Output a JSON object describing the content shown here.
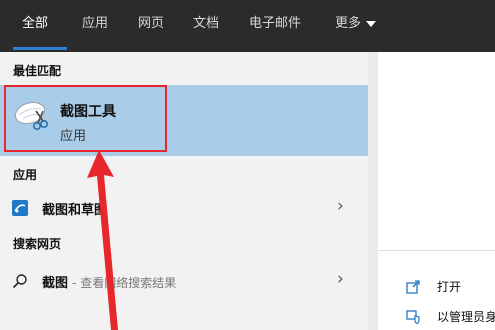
{
  "tabs": [
    {
      "label": "全部",
      "active": true
    },
    {
      "label": "应用"
    },
    {
      "label": "网页"
    },
    {
      "label": "文档"
    },
    {
      "label": "电子邮件"
    },
    {
      "label": "更多"
    }
  ],
  "sections": {
    "best_match": "最佳匹配",
    "apps": "应用",
    "web": "搜索网页"
  },
  "best_match": {
    "title": "截图工具",
    "subtitle": "应用",
    "icon": "snipping-tool-icon"
  },
  "apps": [
    {
      "label": "截图和草图",
      "icon": "snip-sketch-icon"
    }
  ],
  "web_results": [
    {
      "query": "截图",
      "hint": "- 查看网络搜索结果",
      "icon": "search-icon"
    }
  ],
  "actions": [
    {
      "label": "打开",
      "icon": "open-icon"
    },
    {
      "label": "以管理员身",
      "icon": "admin-shield-icon"
    }
  ],
  "colors": {
    "tabbar_bg": "#2b2b2b",
    "accent": "#2d7fd0",
    "selection": "#a9cce9",
    "highlight_box": "#e8272c",
    "arrow": "#e8272c"
  }
}
